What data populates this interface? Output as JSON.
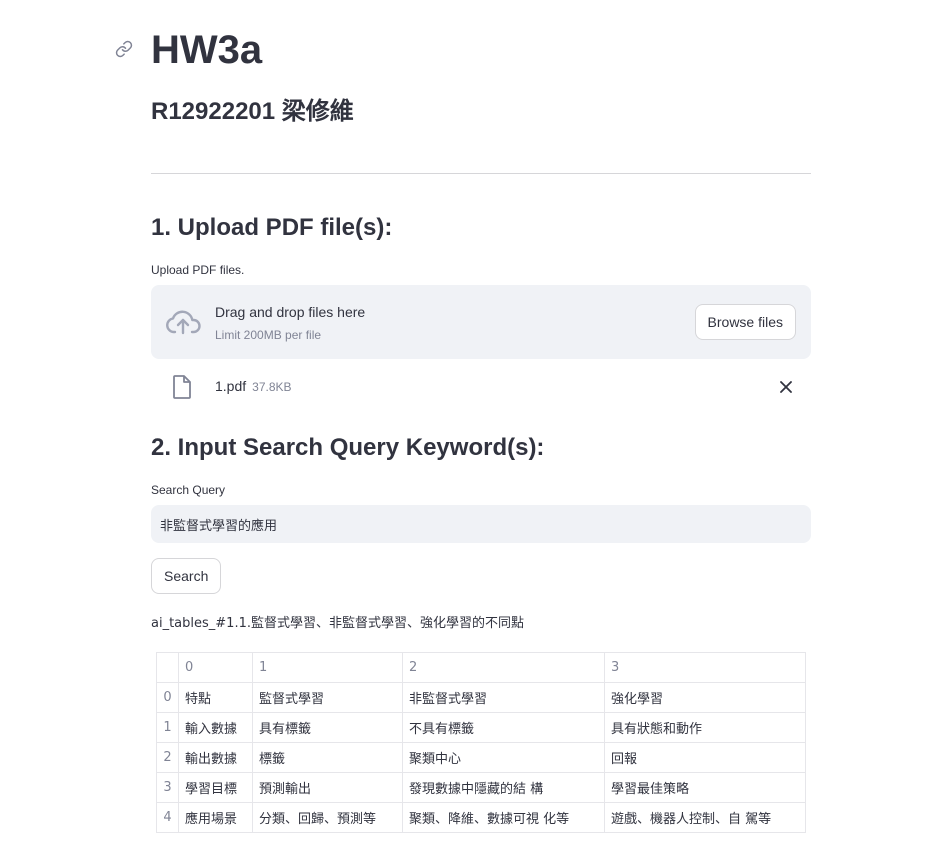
{
  "page": {
    "title": "HW3a",
    "subtitle": "R12922201 梁修維"
  },
  "upload": {
    "heading": "1. Upload PDF file(s):",
    "label": "Upload PDF files.",
    "drag_text": "Drag and drop files here",
    "limit_text": "Limit 200MB per file",
    "browse_label": "Browse files",
    "file": {
      "name": "1.pdf",
      "size": "37.8KB"
    }
  },
  "search": {
    "heading": "2. Input Search Query Keyword(s):",
    "label": "Search Query",
    "value": "非監督式學習的應用",
    "button_label": "Search"
  },
  "result": {
    "title": "ai_tables_#1.1.監督式學習、非監督式學習、強化學習的不同點",
    "columns": [
      "0",
      "1",
      "2",
      "3"
    ],
    "rows": [
      {
        "index": "0",
        "cells": [
          "特點",
          "監督式學習",
          "非監督式學習",
          "強化學習"
        ]
      },
      {
        "index": "1",
        "cells": [
          "輸入數據",
          "具有標籤",
          "不具有標籤",
          "具有狀態和動作"
        ]
      },
      {
        "index": "2",
        "cells": [
          "輸出數據",
          "標籤",
          "聚類中心",
          "回報"
        ]
      },
      {
        "index": "3",
        "cells": [
          "學習目標",
          "預測輸出",
          "發現數據中隱藏的結 構",
          "學習最佳策略"
        ]
      },
      {
        "index": "4",
        "cells": [
          "應用場景",
          "分類、回歸、預測等",
          "聚類、降維、數據可視 化等",
          "遊戲、機器人控制、自 駕等"
        ]
      }
    ]
  },
  "colors": {
    "text": "#31333f",
    "muted": "#808495",
    "input_bg": "#f0f2f6",
    "border": "#d6d6d9"
  },
  "icons": [
    "link-icon",
    "cloud-upload-icon",
    "file-icon",
    "close-icon"
  ]
}
